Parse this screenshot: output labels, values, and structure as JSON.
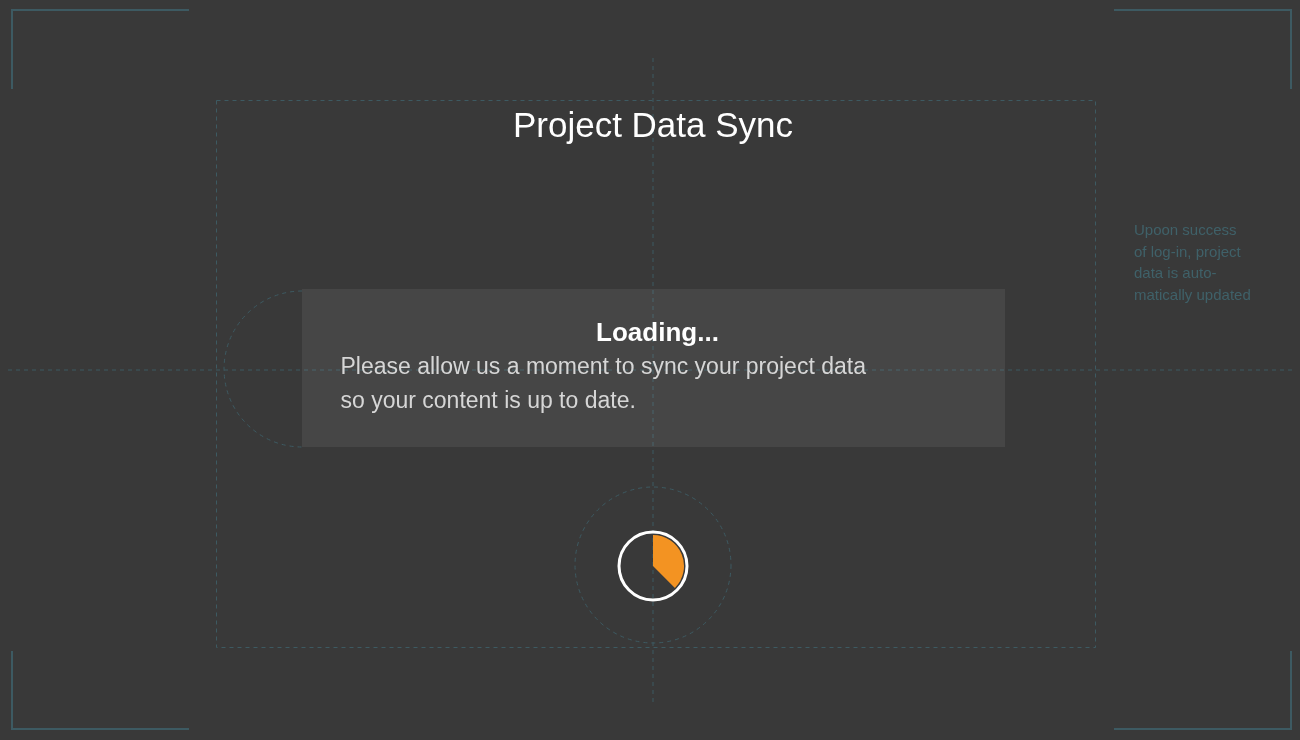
{
  "title": "Project Data Sync",
  "dialog": {
    "heading": "Loading...",
    "message_lines": [
      "Please allow us a moment to sync your project data",
      "so your content is up to date."
    ]
  },
  "annotation_lines": [
    "Upoon success",
    "of log-in, project",
    "data is auto-",
    "matically updated"
  ]
}
